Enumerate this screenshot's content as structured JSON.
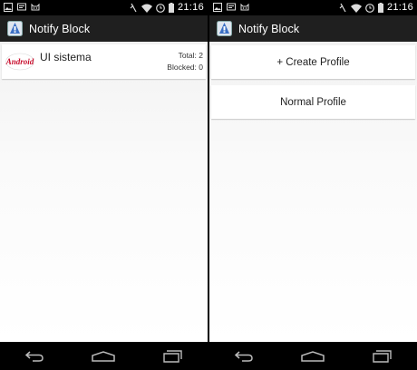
{
  "screens": [
    {
      "status_time": "21:16",
      "app_title": "Notify Block",
      "app_row": {
        "name": "UI sistema",
        "total": "Total: 2",
        "blocked": "Blocked: 0",
        "logo_icon": "android-logo-icon",
        "logo_text": "Android"
      }
    },
    {
      "status_time": "21:16",
      "app_title": "Notify Block",
      "buttons": {
        "create_profile": "+ Create Profile",
        "normal_profile": "Normal Profile"
      }
    }
  ],
  "colors": {
    "status_bar": "#000000",
    "action_bar": "#1f1f1f",
    "content_bg": "#f4f4f4",
    "card_bg": "#ffffff",
    "nav_bar": "#000000",
    "android_red": "#c8102e"
  },
  "icons": {
    "status_left": [
      "image-icon",
      "notification-icon",
      "cat-icon"
    ],
    "status_right": [
      "vibrate-icon",
      "wifi-icon",
      "alarm-icon",
      "battery-icon"
    ],
    "nav": [
      "back-icon",
      "home-icon",
      "recents-icon"
    ],
    "app": "notify-block-app-icon"
  }
}
